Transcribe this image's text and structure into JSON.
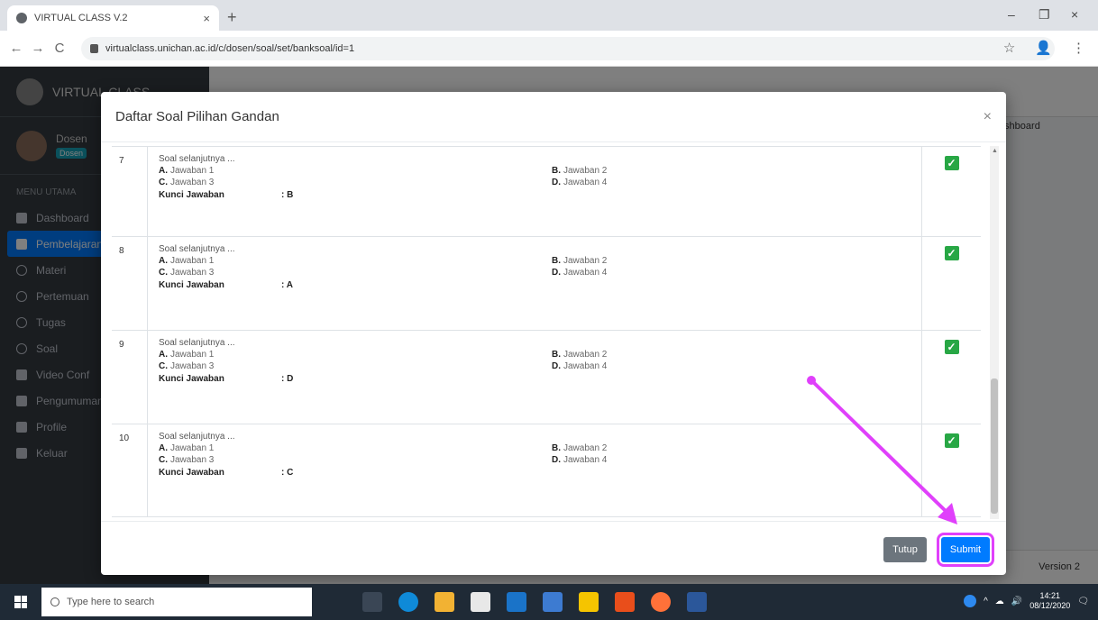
{
  "browser": {
    "tab_title": "VIRTUAL CLASS V.2",
    "new_tab": "+",
    "close_tab": "×",
    "url": "virtualclass.unichan.ac.id/c/dosen/soal/set/banksoal/id=1",
    "back": "←",
    "forward": "→",
    "reload": "C",
    "star": "☆",
    "profile": "👤",
    "menu": "⋮",
    "minimize": "–",
    "restore": "❐",
    "close_window": "×"
  },
  "app": {
    "brand": "VIRTUAL CLASS",
    "user_name": "Dosen",
    "user_badge": "Dosen",
    "nav_header": "MENU UTAMA",
    "nav": [
      {
        "label": "Dashboard",
        "icon": "dashboard-icon"
      },
      {
        "label": "Pembelajaran",
        "icon": "book-icon"
      },
      {
        "label": "Materi",
        "icon": "circle-icon"
      },
      {
        "label": "Pertemuan",
        "icon": "circle-icon"
      },
      {
        "label": "Tugas",
        "icon": "circle-icon"
      },
      {
        "label": "Soal",
        "icon": "circle-icon"
      },
      {
        "label": "Video Conf",
        "icon": "video-icon"
      },
      {
        "label": "Pengumuman",
        "icon": "bullhorn-icon"
      },
      {
        "label": "Profile",
        "icon": "user-icon"
      },
      {
        "label": "Keluar",
        "icon": "logout-icon"
      }
    ],
    "breadcrumb_right": "Dashboard",
    "footer_version": "Version 2"
  },
  "modal": {
    "title": "Daftar Soal Pilihan Gandan",
    "close": "×",
    "questions": [
      {
        "number": "7",
        "text": "Soal selanjutnya ...",
        "a": "Jawaban 1",
        "b": "Jawaban 2",
        "c": "Jawaban 3",
        "d": "Jawaban 4",
        "key_label": "Kunci Jawaban",
        "key_value": ": B",
        "checked": true
      },
      {
        "number": "8",
        "text": "Soal selanjutnya ...",
        "a": "Jawaban 1",
        "b": "Jawaban 2",
        "c": "Jawaban 3",
        "d": "Jawaban 4",
        "key_label": "Kunci Jawaban",
        "key_value": ": A",
        "checked": true
      },
      {
        "number": "9",
        "text": "Soal selanjutnya ...",
        "a": "Jawaban 1",
        "b": "Jawaban 2",
        "c": "Jawaban 3",
        "d": "Jawaban 4",
        "key_label": "Kunci Jawaban",
        "key_value": ": D",
        "checked": true
      },
      {
        "number": "10",
        "text": "Soal selanjutnya ...",
        "a": "Jawaban 1",
        "b": "Jawaban 2",
        "c": "Jawaban 3",
        "d": "Jawaban 4",
        "key_label": "Kunci Jawaban",
        "key_value": ": C",
        "checked": true
      }
    ],
    "option_labels": {
      "a": "A.",
      "b": "B.",
      "c": "C.",
      "d": "D."
    },
    "btn_close": "Tutup",
    "btn_submit": "Submit"
  },
  "taskbar": {
    "search_placeholder": "Type here to search",
    "time": "14:21",
    "date": "08/12/2020"
  },
  "colors": {
    "accent": "#007bff",
    "success": "#28a745",
    "annotation": "#e040fb"
  }
}
